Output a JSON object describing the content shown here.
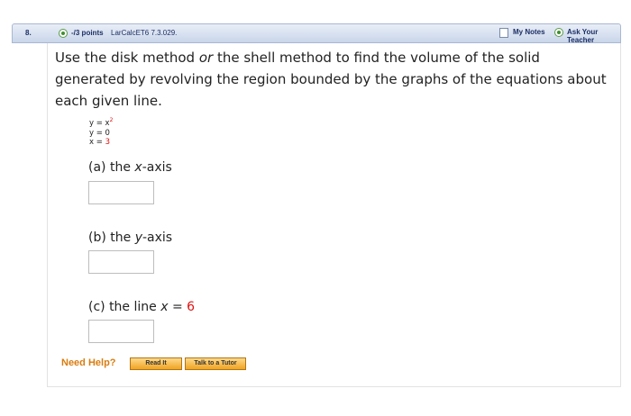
{
  "header": {
    "question_number": "8.",
    "points": "-/3 points",
    "source": "LarCalcET6 7.3.029.",
    "my_notes": "My Notes",
    "ask_teacher": "Ask Your Teacher"
  },
  "question": {
    "prompt_part1": "Use the disk method ",
    "prompt_or": "or",
    "prompt_part2": " the shell method to find the volume of the solid generated by revolving the region bounded by the graphs of the equations about each given line.",
    "equations": {
      "eq1_lhs": "y = x",
      "eq1_exp": "2",
      "eq2": "y = 0",
      "eq3_lhs": "x = ",
      "eq3_val": "3"
    }
  },
  "parts": {
    "a": {
      "prefix": "(a) the ",
      "var": "x",
      "suffix": "-axis",
      "value": ""
    },
    "b": {
      "prefix": "(b) the ",
      "var": "y",
      "suffix": "-axis",
      "value": ""
    },
    "c": {
      "prefix": "(c) the line ",
      "var": "x",
      "eq": " = ",
      "num": "6",
      "value": ""
    }
  },
  "help": {
    "label": "Need Help?",
    "read_it": "Read It",
    "talk_to_tutor": "Talk to a Tutor"
  },
  "colors": {
    "header_text": "#1d2f66",
    "highlight_red": "#d11",
    "help_orange": "#d97c0f"
  }
}
